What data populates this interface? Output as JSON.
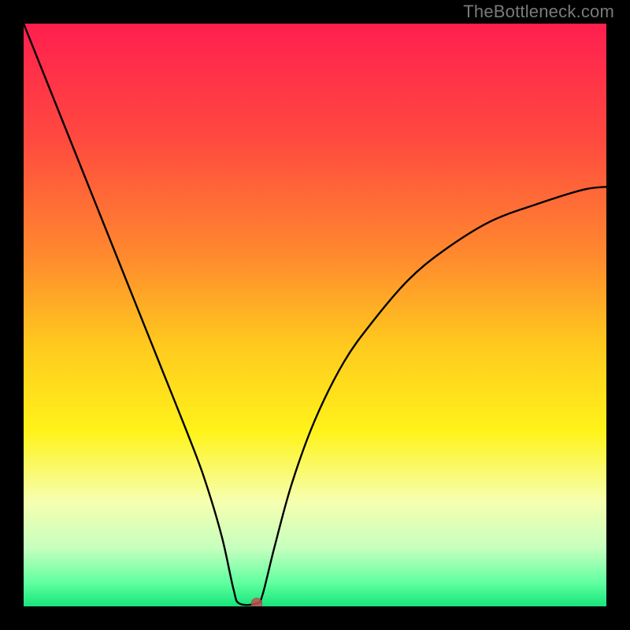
{
  "watermark": "TheBottleneck.com",
  "chart_data": {
    "type": "line",
    "title": "",
    "xlabel": "",
    "ylabel": "",
    "xlim": [
      0,
      100
    ],
    "ylim": [
      0,
      100
    ],
    "background_gradient": {
      "stops": [
        {
          "pos": 0.0,
          "color": "#ff1f4f"
        },
        {
          "pos": 0.2,
          "color": "#ff4a3f"
        },
        {
          "pos": 0.4,
          "color": "#ff8a2e"
        },
        {
          "pos": 0.55,
          "color": "#ffc91e"
        },
        {
          "pos": 0.7,
          "color": "#fff31a"
        },
        {
          "pos": 0.82,
          "color": "#f6ffb0"
        },
        {
          "pos": 0.9,
          "color": "#c6ffbe"
        },
        {
          "pos": 0.96,
          "color": "#5fffa0"
        },
        {
          "pos": 1.0,
          "color": "#17e57a"
        }
      ]
    },
    "curve": {
      "description": "V-shaped bottleneck curve; value ~100 at x=0, drops to ~0 near x≈38–40, rises concavely toward ~72 at x=100",
      "points": [
        {
          "x": 0,
          "y": 100
        },
        {
          "x": 4,
          "y": 90
        },
        {
          "x": 8,
          "y": 80
        },
        {
          "x": 12,
          "y": 70
        },
        {
          "x": 16,
          "y": 60
        },
        {
          "x": 20,
          "y": 50
        },
        {
          "x": 24,
          "y": 40
        },
        {
          "x": 28,
          "y": 30
        },
        {
          "x": 31,
          "y": 22
        },
        {
          "x": 34,
          "y": 12
        },
        {
          "x": 36,
          "y": 3
        },
        {
          "x": 37,
          "y": 0.5
        },
        {
          "x": 40,
          "y": 0.5
        },
        {
          "x": 41,
          "y": 2
        },
        {
          "x": 43,
          "y": 10
        },
        {
          "x": 46,
          "y": 21
        },
        {
          "x": 50,
          "y": 32
        },
        {
          "x": 55,
          "y": 42
        },
        {
          "x": 60,
          "y": 49
        },
        {
          "x": 66,
          "y": 56
        },
        {
          "x": 72,
          "y": 61
        },
        {
          "x": 80,
          "y": 66
        },
        {
          "x": 88,
          "y": 69
        },
        {
          "x": 96,
          "y": 71.5
        },
        {
          "x": 100,
          "y": 72
        }
      ]
    },
    "marker": {
      "x": 40,
      "y": 0.5,
      "color": "#c05050",
      "radius_px": 7
    }
  }
}
